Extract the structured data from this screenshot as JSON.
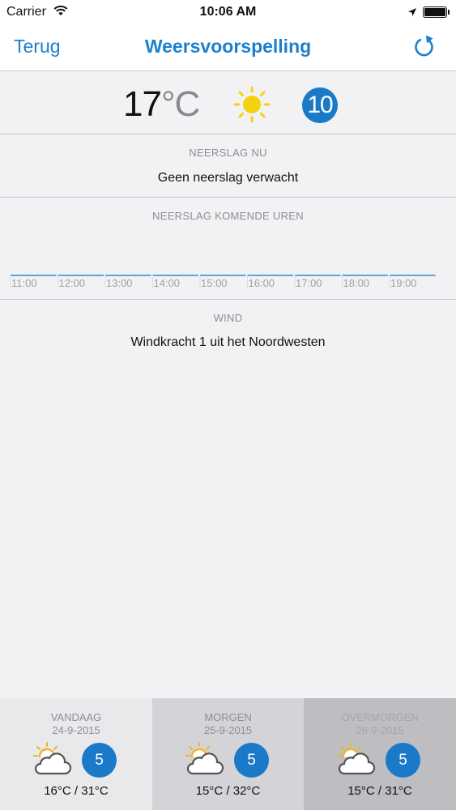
{
  "status_bar": {
    "carrier": "Carrier",
    "time": "10:06 AM"
  },
  "nav": {
    "back_label": "Terug",
    "title": "Weersvoorspelling"
  },
  "current": {
    "temperature": "17",
    "unit": "°C",
    "uv_index": "10"
  },
  "precipitation_now": {
    "label": "NEERSLAG NU",
    "text": "Geen neerslag verwacht"
  },
  "precipitation_hours": {
    "label": "NEERSLAG KOMENDE UREN",
    "times": [
      "11:00",
      "12:00",
      "13:00",
      "14:00",
      "15:00",
      "16:00",
      "17:00",
      "18:00",
      "19:00"
    ]
  },
  "wind": {
    "label": "WIND",
    "text": "Windkracht 1 uit het Noordwesten"
  },
  "forecast": [
    {
      "day": "VANDAAG",
      "date": "24-9-2015",
      "uv": "5",
      "range": "16°C / 31°C"
    },
    {
      "day": "MORGEN",
      "date": "25-9-2015",
      "uv": "5",
      "range": "15°C / 32°C"
    },
    {
      "day": "OVERMORGEN",
      "date": "26-9-2015",
      "uv": "5",
      "range": "15°C / 31°C"
    }
  ],
  "colors": {
    "accent": "#1c7fcc",
    "uv_badge": "#1a7ac8",
    "sun": "#f5d20f"
  },
  "icons": {
    "refresh": "refresh-icon",
    "sun": "sun-icon",
    "partly_cloudy": "partly-cloudy-icon"
  }
}
